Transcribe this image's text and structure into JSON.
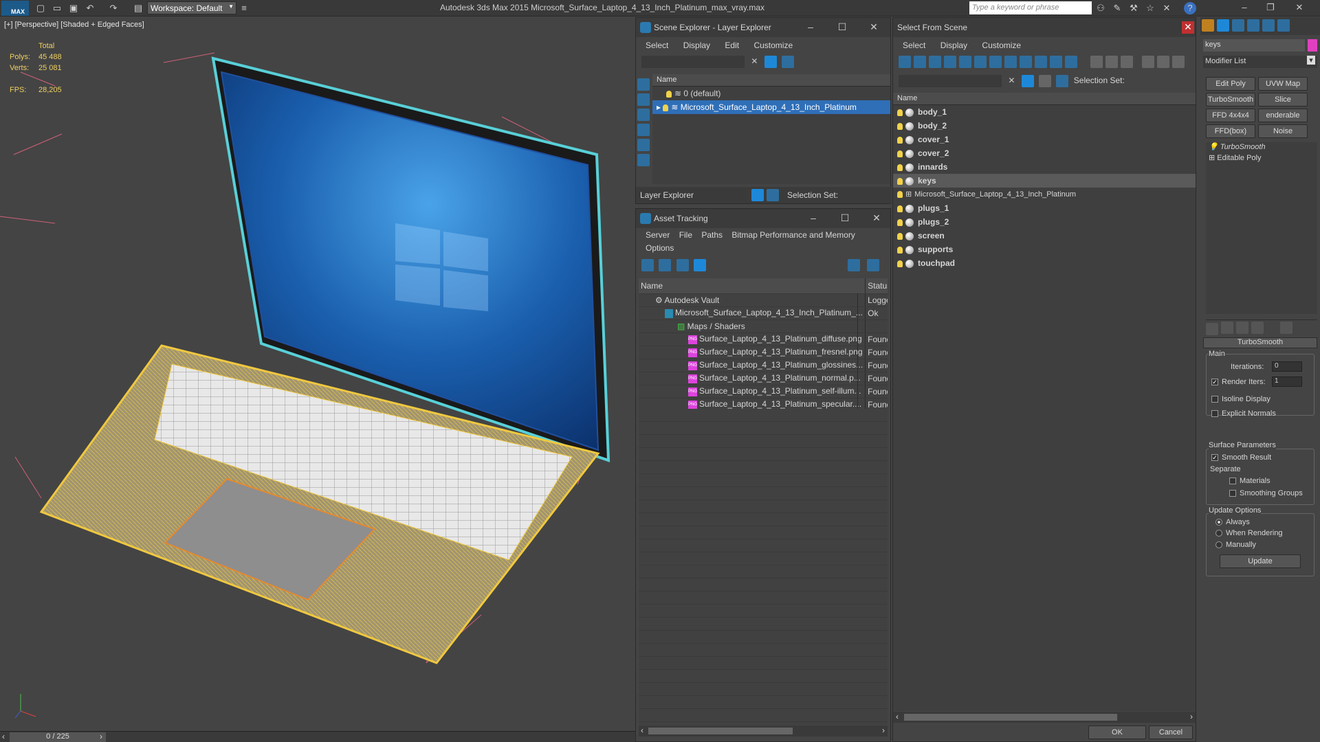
{
  "titlebar": {
    "logo": "MAX",
    "workspace": "Workspace: Default",
    "app_title": "Autodesk 3ds Max  2015    Microsoft_Surface_Laptop_4_13_Inch_Platinum_max_vray.max",
    "search_placeholder": "Type a keyword or phrase"
  },
  "viewport": {
    "label": "[+] [Perspective] [Shaded + Edged Faces]",
    "stats": {
      "total_label": "Total",
      "polys_label": "Polys:",
      "polys": "45 488",
      "verts_label": "Verts:",
      "verts": "25 081",
      "fps_label": "FPS:",
      "fps": "28,205"
    },
    "timeline": "0 / 225"
  },
  "scene_explorer": {
    "title": "Scene Explorer - Layer Explorer",
    "menu": [
      "Select",
      "Display",
      "Edit",
      "Customize"
    ],
    "col_name": "Name",
    "rows": [
      {
        "label": "0 (default)"
      },
      {
        "label": "Microsoft_Surface_Laptop_4_13_Inch_Platinum"
      }
    ],
    "footer_dropdown": "Layer Explorer",
    "selection_set": "Selection Set:"
  },
  "asset_tracking": {
    "title": "Asset Tracking",
    "menu": [
      "Server",
      "File",
      "Paths",
      "Bitmap Performance and Memory"
    ],
    "menu2": "Options",
    "col_name": "Name",
    "col_status": "Status",
    "rows": [
      {
        "name": "Autodesk Vault",
        "status": "Logged"
      },
      {
        "name": "Microsoft_Surface_Laptop_4_13_Inch_Platinum_...",
        "status": "Ok"
      },
      {
        "name": "Maps / Shaders",
        "status": ""
      },
      {
        "name": "Surface_Laptop_4_13_Platinum_diffuse.png",
        "status": "Found"
      },
      {
        "name": "Surface_Laptop_4_13_Platinum_fresnel.png",
        "status": "Found"
      },
      {
        "name": "Surface_Laptop_4_13_Platinum_glossines...",
        "status": "Found"
      },
      {
        "name": "Surface_Laptop_4_13_Platinum_normal.p...",
        "status": "Found"
      },
      {
        "name": "Surface_Laptop_4_13_Platinum_self-illum...",
        "status": "Found"
      },
      {
        "name": "Surface_Laptop_4_13_Platinum_specular....",
        "status": "Found"
      }
    ]
  },
  "select_from_scene": {
    "title": "Select From Scene",
    "menu": [
      "Select",
      "Display",
      "Customize"
    ],
    "selection_set": "Selection Set:",
    "col_name": "Name",
    "items": [
      {
        "label": "body_1"
      },
      {
        "label": "body_2"
      },
      {
        "label": "cover_1"
      },
      {
        "label": "cover_2"
      },
      {
        "label": "innards"
      },
      {
        "label": "keys"
      },
      {
        "label": "Microsoft_Surface_Laptop_4_13_Inch_Platinum"
      },
      {
        "label": "plugs_1"
      },
      {
        "label": "plugs_2"
      },
      {
        "label": "screen"
      },
      {
        "label": "supports"
      },
      {
        "label": "touchpad"
      }
    ],
    "ok": "OK",
    "cancel": "Cancel"
  },
  "command_panel": {
    "object_name": "keys",
    "modifier_list": "Modifier List",
    "buttons": [
      "Edit Poly",
      "UVW Map",
      "TurboSmooth",
      "Slice",
      "FFD 4x4x4",
      "enderable Splir",
      "FFD(box)",
      "Noise"
    ],
    "stack": [
      "TurboSmooth",
      "Editable Poly"
    ],
    "rollout_title": "TurboSmooth",
    "main_label": "Main",
    "iterations_label": "Iterations:",
    "iterations": "0",
    "render_iters_label": "Render Iters:",
    "render_iters": "1",
    "isoline": "Isoline Display",
    "explicit_normals": "Explicit Normals",
    "surface_params": "Surface Parameters",
    "smooth_result": "Smooth Result",
    "separate": "Separate",
    "materials": "Materials",
    "smoothing_groups": "Smoothing Groups",
    "update_options": "Update Options",
    "always": "Always",
    "when_rendering": "When Rendering",
    "manually": "Manually",
    "update": "Update"
  }
}
